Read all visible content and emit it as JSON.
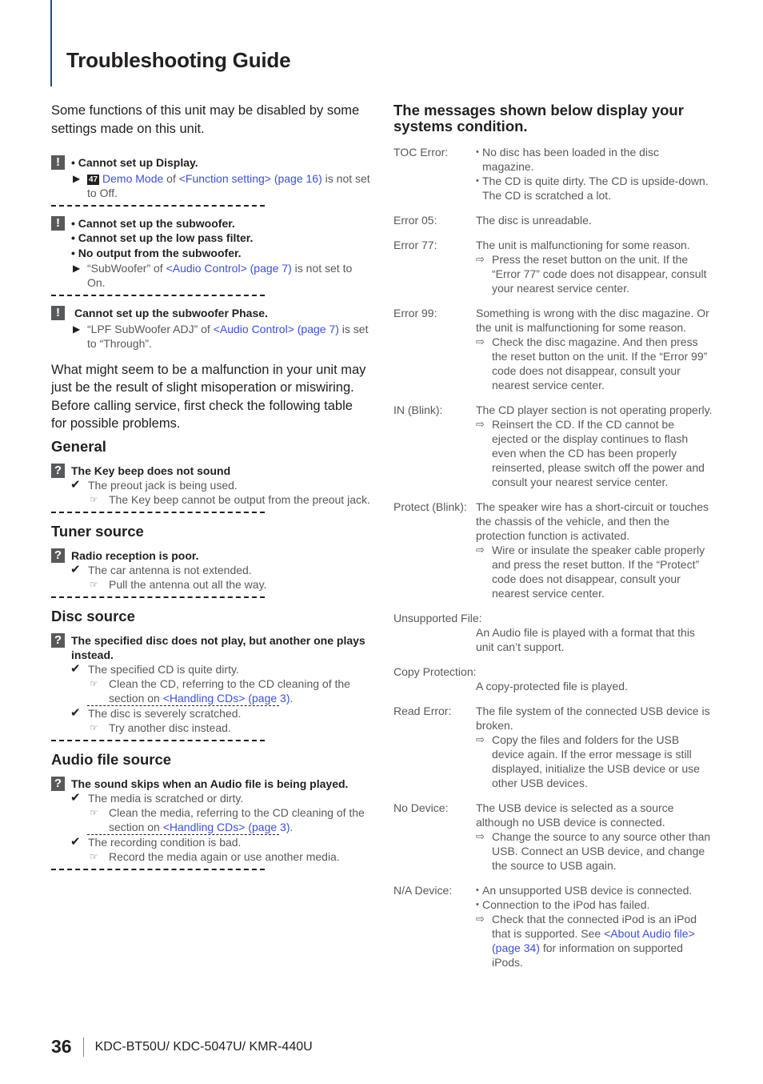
{
  "header": {
    "title": "Troubleshooting Guide"
  },
  "left": {
    "intro": "Some functions of this unit may be disabled by some settings made on this unit.",
    "warnings": [
      {
        "icon": "exclamation",
        "lines": [
          "• Cannot set up Display."
        ],
        "note": {
          "badge": "47",
          "link1": "Demo Mode",
          "mid": " of ",
          "link2": "<Function setting> (page 16)",
          "tail": " is not set to Off."
        }
      },
      {
        "icon": "exclamation",
        "lines": [
          "• Cannot set up the subwoofer.",
          "• Cannot set up the low pass filter.",
          "• No output from the subwoofer."
        ],
        "note": {
          "pre": "“SubWoofer” of ",
          "link": "<Audio Control> (page 7)",
          "tail": " is not set to On."
        }
      },
      {
        "icon": "exclamation",
        "lines": [
          "Cannot set up the subwoofer Phase."
        ],
        "note": {
          "pre": "“LPF SubWoofer ADJ” of ",
          "link": "<Audio Control> (page 7)",
          "tail": " is set to “Through”."
        }
      }
    ],
    "intro2": "What might seem to be a malfunction in your unit may just be the result of slight misoperation or miswiring. Before calling service, first check the following table for possible problems.",
    "sections": [
      {
        "title": "General",
        "problem": "The Key beep does not sound",
        "causes": [
          {
            "cause": "The preout jack is being used.",
            "remedy": "The Key beep cannot be output from the preout jack."
          }
        ]
      },
      {
        "title": "Tuner source",
        "problem": "Radio reception is poor.",
        "causes": [
          {
            "cause": "The car antenna is not extended.",
            "remedy": "Pull the antenna out all the way."
          }
        ]
      },
      {
        "title": "Disc source",
        "problem": "The specified disc does not play, but another one plays instead.",
        "causes": [
          {
            "cause": "The specified CD is quite dirty.",
            "remedy_pre": "Clean the CD, referring to the CD cleaning of the section on ",
            "remedy_link": "<Handling CDs> (page 3)",
            "remedy_tail": "."
          },
          {
            "cause": "The disc is severely scratched.",
            "remedy": "Try another disc instead."
          }
        ]
      },
      {
        "title": "Audio file source",
        "problem": "The sound skips when an Audio file is being played.",
        "causes": [
          {
            "cause": "The media is scratched or dirty.",
            "remedy_pre": "Clean the media, referring to the CD cleaning of the section on ",
            "remedy_link": "<Handling CDs> (page 3)",
            "remedy_tail": "."
          },
          {
            "cause": "The recording condition is bad.",
            "remedy": "Record the media again or use another media."
          }
        ]
      }
    ]
  },
  "right": {
    "heading": "The messages shown below display your systems condition.",
    "messages": [
      {
        "label": "TOC Error:",
        "bullets": [
          "No disc has been loaded in the disc magazine.",
          "The CD is quite dirty. The CD is upside-down. The CD is scratched a lot."
        ]
      },
      {
        "label": "Error 05:",
        "text": "The disc is unreadable."
      },
      {
        "label": "Error 77:",
        "text": "The unit is malfunctioning for some reason.",
        "fix": "Press the reset button on the unit. If the “Error 77” code does not disappear, consult your nearest service center."
      },
      {
        "label": "Error 99:",
        "text": "Something is wrong with the disc magazine. Or the unit is malfunctioning for some reason.",
        "fix": "Check the disc magazine. And then press the reset button on the unit. If the “Error 99” code does not disappear, consult your nearest service center."
      },
      {
        "label": "IN (Blink):",
        "text": "The CD player section is not operating properly.",
        "fix": "Reinsert the CD. If the CD cannot be ejected or the display continues to flash even when the CD has been properly reinserted, please switch off the power and consult your nearest service center."
      },
      {
        "label": "Protect (Blink):",
        "text": "The speaker wire has a short-circuit or touches the chassis of the vehicle, and then the protection function is activated.",
        "fix": "Wire or insulate the speaker cable properly and press the reset button. If the “Protect” code does not disappear, consult your nearest service center."
      },
      {
        "label": "Unsupported File:",
        "text": "An Audio file is played with a format that this unit can’t support."
      },
      {
        "label": "Copy Protection:",
        "text": "A copy-protected file is played."
      },
      {
        "label": "Read Error:",
        "text": "The file system of the connected USB device is broken.",
        "fix": "Copy the files and folders for the USB device again. If the error message is still displayed, initialize the USB device or use other USB devices."
      },
      {
        "label": "No Device:",
        "text": "The USB device is selected as a source although no USB device is connected.",
        "fix": "Change the source to any source other than USB. Connect an USB device, and change the source to USB again."
      },
      {
        "label": "N/A Device:",
        "bullets": [
          "An unsupported USB device is connected.",
          "Connection to the iPod has failed."
        ],
        "fix_pre": "Check that the connected iPod is an iPod that is supported. See ",
        "fix_link": "<About Audio file> (page 34)",
        "fix_tail": " for information on supported iPods."
      }
    ]
  },
  "footer": {
    "page_number": "36",
    "models": "KDC-BT50U/ KDC-5047U/ KMR-440U"
  },
  "icons": {
    "warning": "!",
    "question": "?",
    "arrow": "▶",
    "check": "✔",
    "hand": "☞",
    "fix_arrow": "⇨"
  }
}
